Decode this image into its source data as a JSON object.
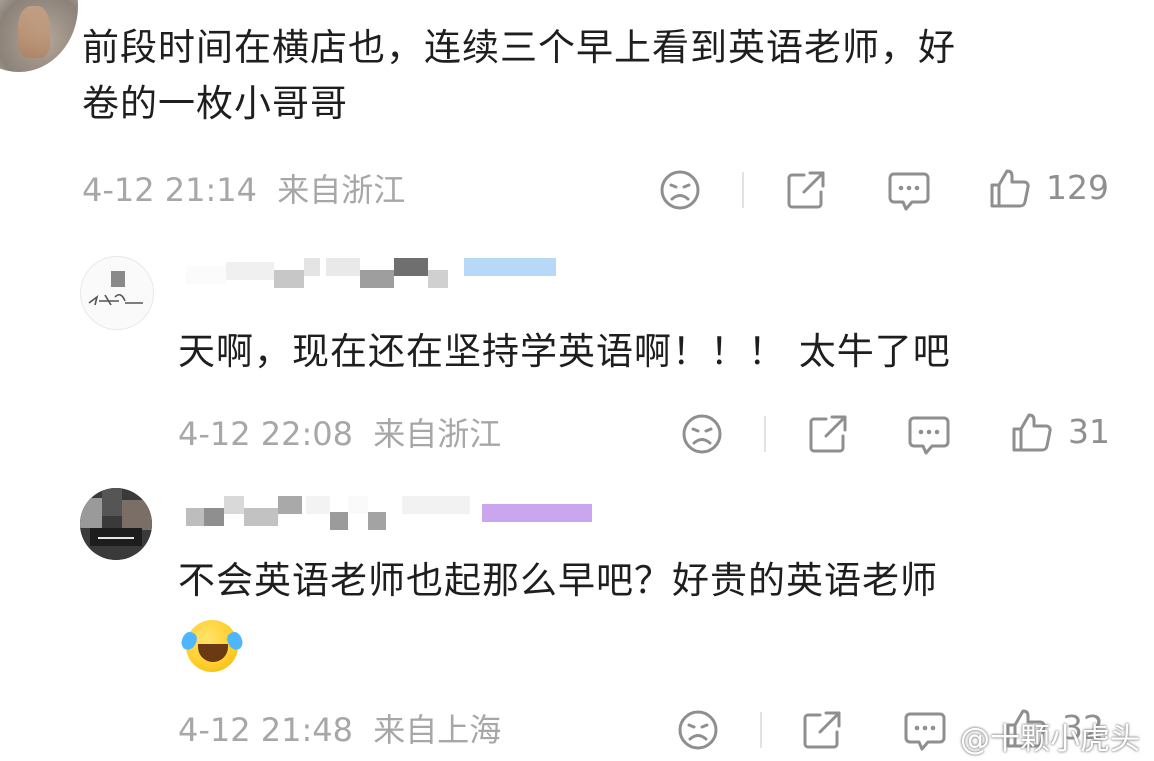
{
  "comments": [
    {
      "text": "前段时间在横店也，连续三个早上看到英语老师，好卷的一枚小哥哥",
      "text_line1": "前段时间在横店也，连续三个早上看到英语老师，好",
      "text_line2": "卷的一枚小哥哥",
      "date": "4-12 21:14",
      "location": "来自浙江",
      "likes": "129"
    },
    {
      "text": "天啊，现在还在坚持学英语啊！！！ 太牛了吧",
      "date": "4-12 22:08",
      "location": "来自浙江",
      "likes": "31"
    },
    {
      "text": "不会英语老师也起那么早吧？好贵的英语老师",
      "date": "4-12 21:48",
      "location": "来自上海",
      "likes": "32"
    }
  ],
  "icons": {
    "dislike": "sad-face-icon",
    "share": "share-icon",
    "comment": "comment-icon",
    "like": "thumbs-up-icon",
    "emoji": "laughing-crying-emoji-icon"
  },
  "watermark": "@十颗小虎头",
  "colors": {
    "text": "#1e1e1e",
    "meta": "#a7a7a7",
    "icon": "#8f8f8f"
  }
}
